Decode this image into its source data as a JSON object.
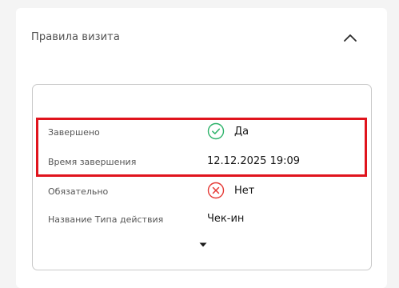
{
  "section": {
    "title": "Правила визита"
  },
  "details": {
    "rows": [
      {
        "label": "Завершено",
        "value": "Да",
        "status": "yes",
        "icon": "check-circle-icon"
      },
      {
        "label": "Время завершения",
        "value": "12.12.2025 19:09"
      },
      {
        "label": "Обязательно",
        "value": "Нет",
        "status": "no",
        "icon": "cross-circle-icon"
      },
      {
        "label": "Название Типа действия",
        "value": "Чек-ин"
      }
    ]
  },
  "colors": {
    "success": "#2db36a",
    "danger": "#e53935",
    "highlight_border": "#e0141d"
  }
}
